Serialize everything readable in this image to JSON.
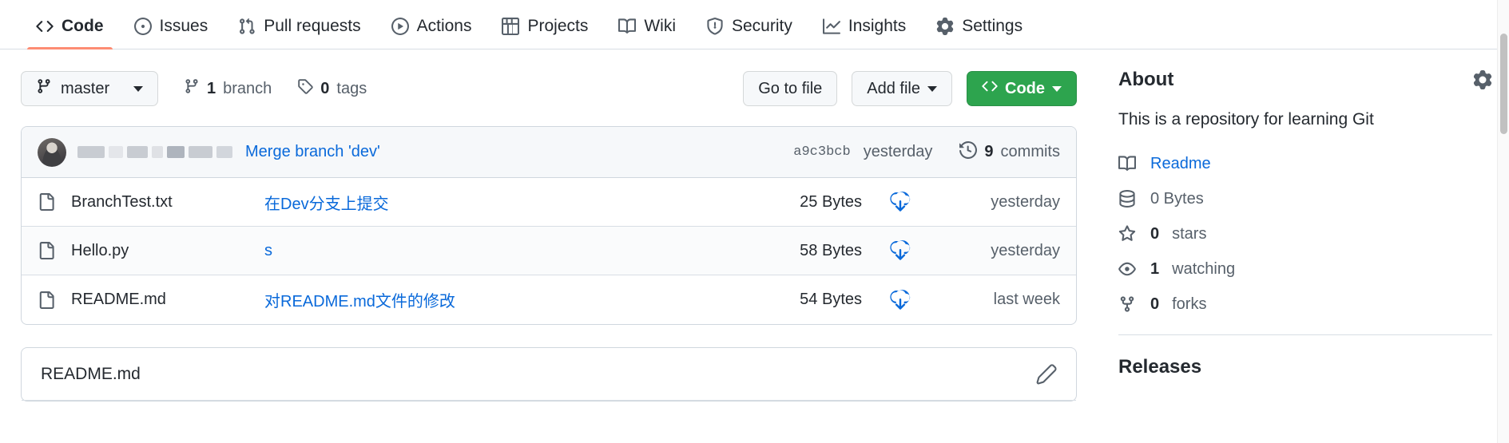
{
  "repo_nav": {
    "items": [
      {
        "label": "Code",
        "icon": "code-icon",
        "selected": true
      },
      {
        "label": "Issues",
        "icon": "issue-opened-icon",
        "selected": false
      },
      {
        "label": "Pull requests",
        "icon": "git-pull-request-icon",
        "selected": false
      },
      {
        "label": "Actions",
        "icon": "play-icon",
        "selected": false
      },
      {
        "label": "Projects",
        "icon": "table-icon",
        "selected": false
      },
      {
        "label": "Wiki",
        "icon": "book-icon",
        "selected": false
      },
      {
        "label": "Security",
        "icon": "shield-icon",
        "selected": false
      },
      {
        "label": "Insights",
        "icon": "graph-icon",
        "selected": false
      },
      {
        "label": "Settings",
        "icon": "gear-icon",
        "selected": false
      }
    ]
  },
  "toolbar": {
    "branch_label": "master",
    "branch_count": "1",
    "branch_word": "branch",
    "tag_count": "0",
    "tag_word": "tags",
    "go_to_file_label": "Go to file",
    "add_file_label": "Add file",
    "code_label": "Code",
    "code_button_color": "#2da44e"
  },
  "commit_bar": {
    "author_redacted": true,
    "message": "Merge branch 'dev'",
    "hash": "a9c3bcb",
    "date": "yesterday",
    "commits_count": "9",
    "commits_word": "commits"
  },
  "files": {
    "rows": [
      {
        "name": "BranchTest.txt",
        "message": "在Dev分支上提交",
        "size": "25 Bytes",
        "date": "yesterday"
      },
      {
        "name": "Hello.py",
        "message": "s",
        "size": "58 Bytes",
        "date": "yesterday"
      },
      {
        "name": "README.md",
        "message": "对README.md文件的修改",
        "size": "54 Bytes",
        "date": "last week"
      }
    ]
  },
  "readme": {
    "title": "README.md"
  },
  "sidebar": {
    "about_title": "About",
    "description": "This is a repository for learning Git",
    "items": [
      {
        "icon": "book-icon",
        "label": "Readme",
        "muted": false
      },
      {
        "icon": "database-icon",
        "label": "0 Bytes",
        "muted": true
      },
      {
        "icon": "star-icon",
        "count": "0",
        "label": "stars",
        "muted": true
      },
      {
        "icon": "eye-icon",
        "count": "1",
        "label": "watching",
        "muted": true
      },
      {
        "icon": "repo-forked-icon",
        "count": "0",
        "label": "forks",
        "muted": true
      }
    ],
    "releases_title": "Releases"
  }
}
